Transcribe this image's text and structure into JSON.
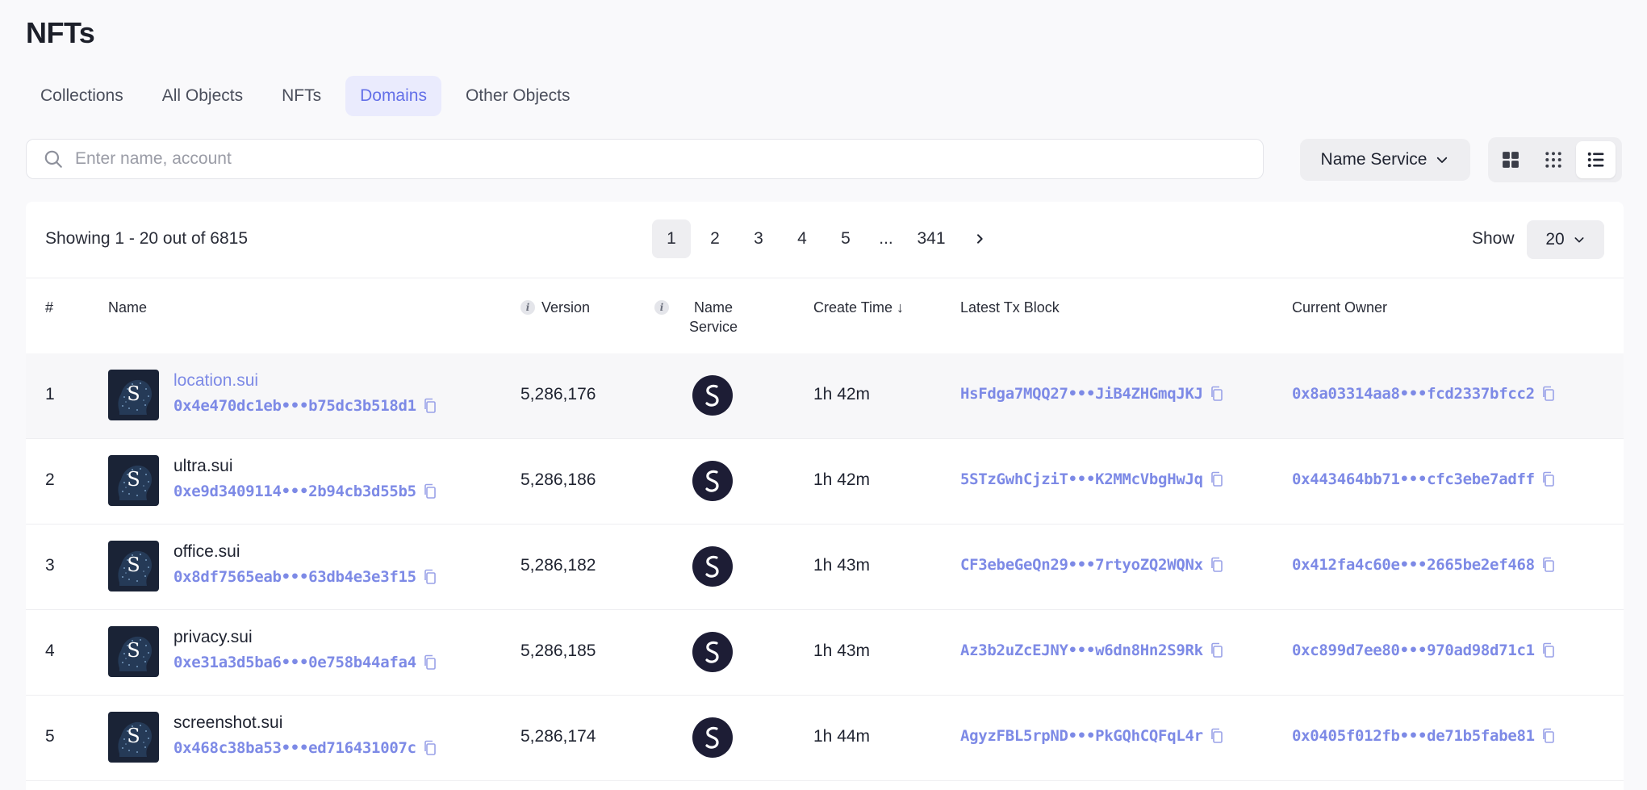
{
  "page": {
    "title": "NFTs"
  },
  "tabs": [
    {
      "label": "Collections",
      "active": false
    },
    {
      "label": "All Objects",
      "active": false
    },
    {
      "label": "NFTs",
      "active": false
    },
    {
      "label": "Domains",
      "active": true
    },
    {
      "label": "Other Objects",
      "active": false
    }
  ],
  "search": {
    "placeholder": "Enter name, account",
    "value": ""
  },
  "filter": {
    "label": "Name Service"
  },
  "view_modes": [
    "grid-large-icon",
    "grid-small-icon",
    "list-icon"
  ],
  "view_mode_active": "list-icon",
  "pagination": {
    "summary": "Showing 1 - 20 out of 6815",
    "pages": [
      "1",
      "2",
      "3",
      "4",
      "5",
      "...",
      "341"
    ],
    "current": "1",
    "show_label": "Show",
    "page_size": "20"
  },
  "table": {
    "headers": {
      "num": "#",
      "name": "Name",
      "version": "Version",
      "name_service": "Name Service",
      "create_time": "Create Time ↓",
      "latest_tx": "Latest Tx Block",
      "owner": "Current Owner"
    },
    "rows": [
      {
        "num": "1",
        "name": "location.sui",
        "address": "0x4e470dc1eb•••b75dc3b518d1",
        "version": "5,286,176",
        "create_time": "1h 42m",
        "tx": "HsFdga7MQQ27•••JiB4ZHGmqJKJ",
        "owner": "0x8a03314aa8•••fcd2337bfcc2"
      },
      {
        "num": "2",
        "name": "ultra.sui",
        "address": "0xe9d3409114•••2b94cb3d55b5",
        "version": "5,286,186",
        "create_time": "1h 42m",
        "tx": "5STzGwhCjziT•••K2MMcVbgHwJq",
        "owner": "0x443464bb71•••cfc3ebe7adff"
      },
      {
        "num": "3",
        "name": "office.sui",
        "address": "0x8df7565eab•••63db4e3e3f15",
        "version": "5,286,182",
        "create_time": "1h 43m",
        "tx": "CF3ebeGeQn29•••7rtyoZQ2WQNx",
        "owner": "0x412fa4c60e•••2665be2ef468"
      },
      {
        "num": "4",
        "name": "privacy.sui",
        "address": "0xe31a3d5ba6•••0e758b44afa4",
        "version": "5,286,185",
        "create_time": "1h 43m",
        "tx": "Az3b2uZcEJNY•••w6dn8Hn2S9Rk",
        "owner": "0xc899d7ee80•••970ad98d71c1"
      },
      {
        "num": "5",
        "name": "screenshot.sui",
        "address": "0x468c38ba53•••ed716431007c",
        "version": "5,286,174",
        "create_time": "1h 44m",
        "tx": "AgyzFBL5rpND•••PkGQhCQFqL4r",
        "owner": "0x0405f012fb•••de71b5fabe81"
      }
    ]
  },
  "colors": {
    "accent": "#7d8ae6",
    "active_tab_bg": "#eaebfd",
    "logo_bg": "#1d1d35"
  }
}
